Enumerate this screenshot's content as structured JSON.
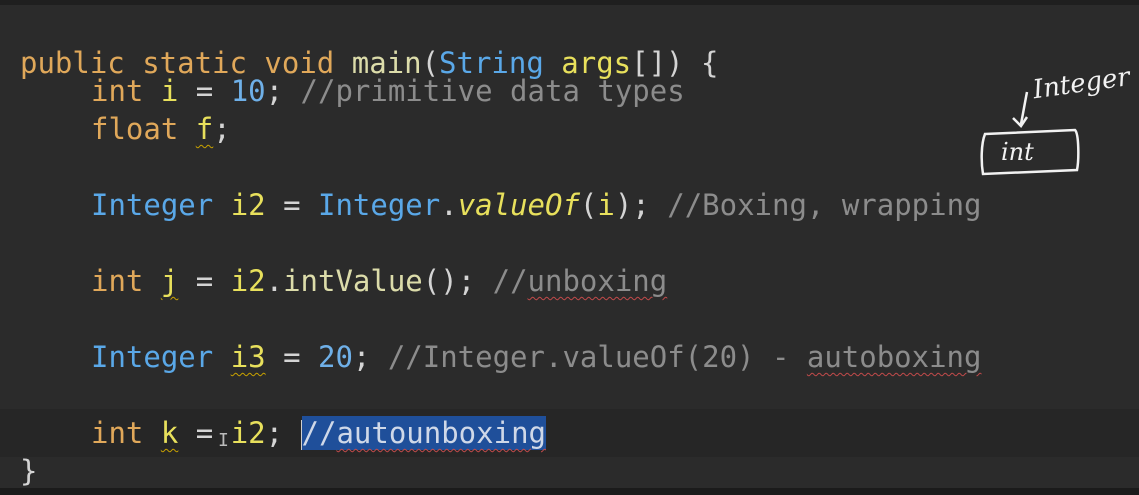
{
  "code": {
    "line0": {
      "kw1": "public static void ",
      "mth": "main",
      "p1": "(",
      "cls": "String",
      "arg": " args",
      "rest": "[]) {"
    },
    "line1": {
      "kw": "int ",
      "var": "i",
      "op": " = ",
      "num": "10",
      "semi": "; ",
      "cmt": "//primitive data types"
    },
    "line2": {
      "kw": "float ",
      "var": "f",
      "semi": ";"
    },
    "line3": {
      "cls": "Integer ",
      "var": "i2",
      "op": " = ",
      "cls2": "Integer",
      "dot": ".",
      "mth": "valueOf",
      "p1": "(",
      "arg": "i",
      "p2": "); ",
      "cmt": "//Boxing, wrapping"
    },
    "line4": {
      "kw": "int ",
      "var": "j",
      "op": " = ",
      "v2": "i2",
      "dot": ".",
      "mth": "intValue",
      "p": "(); ",
      "cmt1": "//",
      "cmt2": "unboxing"
    },
    "line5": {
      "cls": "Integer ",
      "var": "i3",
      "op": " = ",
      "num": "20",
      "semi": "; ",
      "cmt1": "//Integer.valueOf(20) - ",
      "cmt2": "autoboxing"
    },
    "line6": {
      "kw": "int ",
      "var": "k",
      "op": " = ",
      "v2": "i2",
      "semi": "; ",
      "cmt1": "//",
      "cmt2": "autounboxing"
    },
    "line7": {
      "brace": "}"
    }
  },
  "annotation": {
    "label": "Integer",
    "box": "int"
  },
  "colors": {
    "background": "#2b2b2b",
    "keyword": "#e0a85a",
    "class": "#5aa8e8",
    "variable": "#e8e05c",
    "comment": "#8c8c8c",
    "selection": "#1f4f9a"
  }
}
